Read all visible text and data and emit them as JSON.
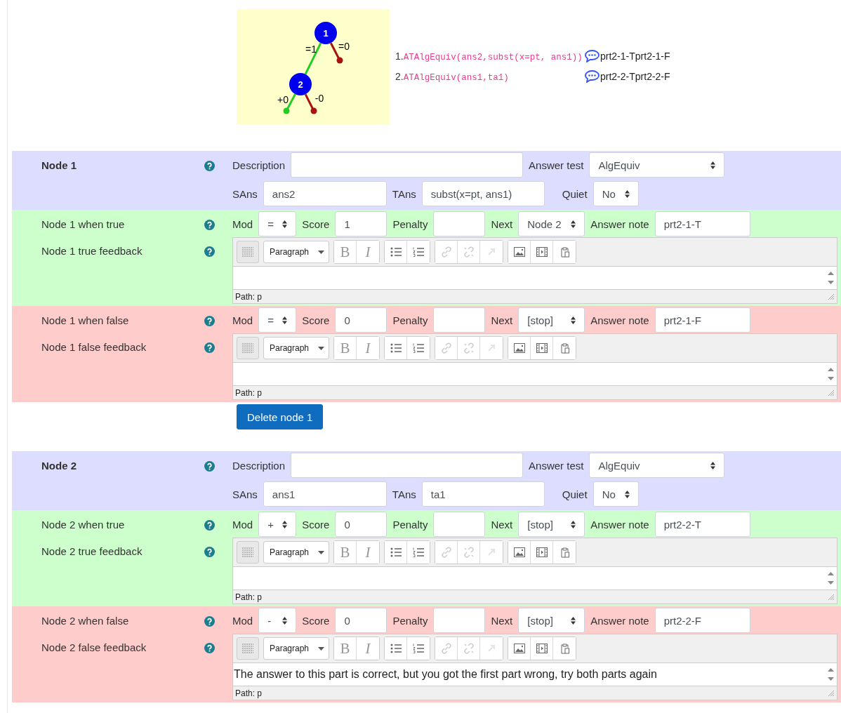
{
  "tree": {
    "nodes": [
      {
        "number": "1",
        "true_label": "=1",
        "false_label": "=0"
      },
      {
        "number": "2",
        "true_label": "+0",
        "false_label": "-0"
      }
    ]
  },
  "tests": [
    {
      "index": "1.",
      "test": "ATAlgEquiv(ans2,subst(x=pt, ans1))",
      "true_note": "prt2-1-T",
      "false_note": "prt2-1-F"
    },
    {
      "index": "2.",
      "test": "ATAlgEquiv(ans1,ta1)",
      "true_note": "prt2-2-T",
      "false_note": "prt2-2-F"
    }
  ],
  "nodes": [
    {
      "title": "Node 1",
      "description_label": "Description",
      "answer_test_label": "Answer test",
      "answer_test": "AlgEquiv",
      "sans_label": "SAns",
      "sans": "ans2",
      "tans_label": "TAns",
      "tans": "subst(x=pt, ans1)",
      "quiet_label": "Quiet",
      "quiet": "No",
      "branches": [
        {
          "kind": "true",
          "title": "Node 1 when true",
          "mod_label": "Mod",
          "mod": "=",
          "score_label": "Score",
          "score": "1",
          "penalty_label": "Penalty",
          "next_label": "Next",
          "next": "Node 2",
          "note_label": "Answer note",
          "note": "prt2-1-T",
          "feedback_title": "Node 1 true feedback",
          "editor": {
            "format": "Paragraph",
            "bold": "B",
            "italic": "I",
            "path": "Path: p"
          }
        },
        {
          "kind": "false",
          "title": "Node 1 when false",
          "mod_label": "Mod",
          "mod": "=",
          "score_label": "Score",
          "score": "0",
          "penalty_label": "Penalty",
          "next_label": "Next",
          "next": "[stop]",
          "note_label": "Answer note",
          "note": "prt2-1-F",
          "feedback_title": "Node 1 false feedback",
          "editor": {
            "format": "Paragraph",
            "bold": "B",
            "italic": "I",
            "path": "Path: p"
          }
        }
      ],
      "delete_button": "Delete node 1"
    },
    {
      "title": "Node 2",
      "description_label": "Description",
      "answer_test_label": "Answer test",
      "answer_test": "AlgEquiv",
      "sans_label": "SAns",
      "sans": "ans1",
      "tans_label": "TAns",
      "tans": "ta1",
      "quiet_label": "Quiet",
      "quiet": "No",
      "branches": [
        {
          "kind": "true",
          "title": "Node 2 when true",
          "mod_label": "Mod",
          "mod": "+",
          "score_label": "Score",
          "score": "0",
          "penalty_label": "Penalty",
          "next_label": "Next",
          "next": "[stop]",
          "note_label": "Answer note",
          "note": "prt2-2-T",
          "feedback_title": "Node 2 true feedback",
          "editor": {
            "format": "Paragraph",
            "bold": "B",
            "italic": "I",
            "path": "Path: p"
          }
        },
        {
          "kind": "false",
          "title": "Node 2 when false",
          "mod_label": "Mod",
          "mod": "-",
          "score_label": "Score",
          "score": "0",
          "penalty_label": "Penalty",
          "next_label": "Next",
          "next": "[stop]",
          "note_label": "Answer note",
          "note": "prt2-2-F",
          "feedback_title": "Node 2 false feedback",
          "editor": {
            "format": "Paragraph",
            "bold": "B",
            "italic": "I",
            "content": "The answer to this part is correct, but you got the first part wrong, try both parts again",
            "path": "Path: p"
          }
        }
      ]
    }
  ]
}
